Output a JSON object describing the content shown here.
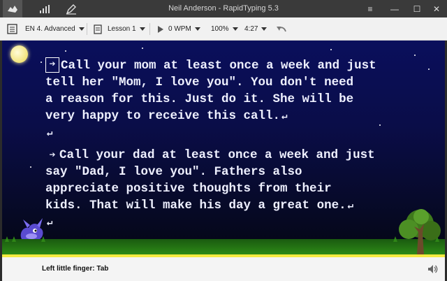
{
  "titlebar": {
    "title": "Neil Anderson - RapidTyping 5.3",
    "icons": [
      "keyboard-icon",
      "statistics-icon",
      "editor-icon"
    ],
    "controls": {
      "menu": "≡",
      "minimize": "—",
      "maximize": "☐",
      "close": "✕"
    }
  },
  "toolbar": {
    "course": "EN 4. Advanced",
    "lesson": "Lesson 1",
    "speed": "0 WPM",
    "zoom": "100%",
    "time": "4:27"
  },
  "lesson": {
    "paragraph1": [
      "Call your mom at least once a week and just",
      "tell her \"Mom, I love you\". You don't need",
      "a reason for this. Just do it. She will be",
      "very happy to receive this call."
    ],
    "paragraph2": [
      "Call your dad at least once a week and just",
      "say \"Dad, I love you\". Fathers also",
      "appreciate positive thoughts from their",
      "kids. That will make his day a great one."
    ],
    "tab_glyph": "➔",
    "return_glyph": "↵"
  },
  "status": {
    "hint": "Left little finger: Tab"
  },
  "colors": {
    "progress": "#f5ea41",
    "sky_top": "#0a0f5c",
    "text": "#eef0ff"
  }
}
